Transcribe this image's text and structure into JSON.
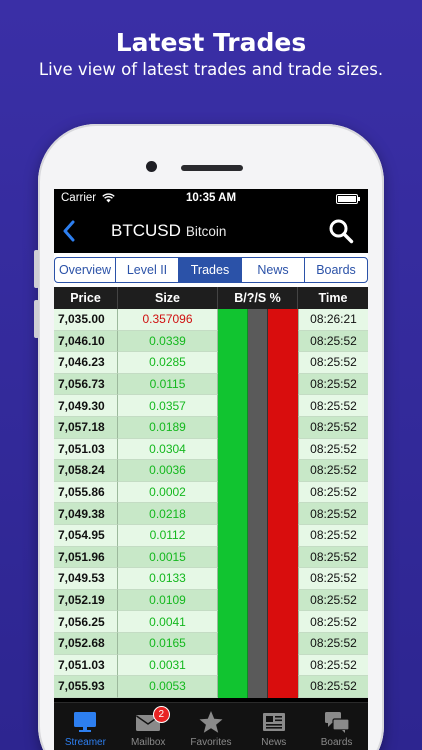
{
  "promo": {
    "title": "Latest Trades",
    "subtitle": "Live view of latest trades and trade sizes."
  },
  "status_bar": {
    "carrier": "Carrier",
    "time": "10:35 AM"
  },
  "nav": {
    "symbol": "BTCUSD",
    "name": "Bitcoin"
  },
  "tabs": [
    {
      "label": "Overview",
      "active": false
    },
    {
      "label": "Level II",
      "active": false
    },
    {
      "label": "Trades",
      "active": true
    },
    {
      "label": "News",
      "active": false
    },
    {
      "label": "Boards",
      "active": false
    }
  ],
  "table": {
    "headers": [
      "Price",
      "Size",
      "B/?/S %",
      "Time"
    ],
    "rows": [
      {
        "price": "7,035.00",
        "size": "0.357096",
        "time": "08:26:21",
        "size_color": "#d01010"
      },
      {
        "price": "7,046.10",
        "size": "0.0339",
        "time": "08:25:52",
        "size_color": "#14b81e"
      },
      {
        "price": "7,046.23",
        "size": "0.0285",
        "time": "08:25:52",
        "size_color": "#14b81e"
      },
      {
        "price": "7,056.73",
        "size": "0.0115",
        "time": "08:25:52",
        "size_color": "#14b81e"
      },
      {
        "price": "7,049.30",
        "size": "0.0357",
        "time": "08:25:52",
        "size_color": "#14b81e"
      },
      {
        "price": "7,057.18",
        "size": "0.0189",
        "time": "08:25:52",
        "size_color": "#14b81e"
      },
      {
        "price": "7,051.03",
        "size": "0.0304",
        "time": "08:25:52",
        "size_color": "#14b81e"
      },
      {
        "price": "7,058.24",
        "size": "0.0036",
        "time": "08:25:52",
        "size_color": "#14b81e"
      },
      {
        "price": "7,055.86",
        "size": "0.0002",
        "time": "08:25:52",
        "size_color": "#14b81e"
      },
      {
        "price": "7,049.38",
        "size": "0.0218",
        "time": "08:25:52",
        "size_color": "#14b81e"
      },
      {
        "price": "7,054.95",
        "size": "0.0112",
        "time": "08:25:52",
        "size_color": "#14b81e"
      },
      {
        "price": "7,051.96",
        "size": "0.0015",
        "time": "08:25:52",
        "size_color": "#14b81e"
      },
      {
        "price": "7,049.53",
        "size": "0.0133",
        "time": "08:25:52",
        "size_color": "#14b81e"
      },
      {
        "price": "7,052.19",
        "size": "0.0109",
        "time": "08:25:52",
        "size_color": "#14b81e"
      },
      {
        "price": "7,056.25",
        "size": "0.0041",
        "time": "08:25:52",
        "size_color": "#14b81e"
      },
      {
        "price": "7,052.68",
        "size": "0.0165",
        "time": "08:25:52",
        "size_color": "#14b81e"
      },
      {
        "price": "7,051.03",
        "size": "0.0031",
        "time": "08:25:52",
        "size_color": "#14b81e"
      },
      {
        "price": "7,055.93",
        "size": "0.0053",
        "time": "08:25:52",
        "size_color": "#14b81e"
      }
    ]
  },
  "tabbar": [
    {
      "label": "Streamer",
      "icon": "monitor-icon",
      "active": true
    },
    {
      "label": "Mailbox",
      "icon": "envelope-icon",
      "active": false,
      "badge": "2"
    },
    {
      "label": "Favorites",
      "icon": "star-icon",
      "active": false
    },
    {
      "label": "News",
      "icon": "newspaper-icon",
      "active": false
    },
    {
      "label": "Boards",
      "icon": "chat-bubbles-icon",
      "active": false
    }
  ],
  "colors": {
    "background": "#3a2fa6",
    "accent_blue": "#2b52a8",
    "buy_green": "#11c430",
    "sell_red": "#d90d0d",
    "active_tab": "#2d7ff0"
  }
}
